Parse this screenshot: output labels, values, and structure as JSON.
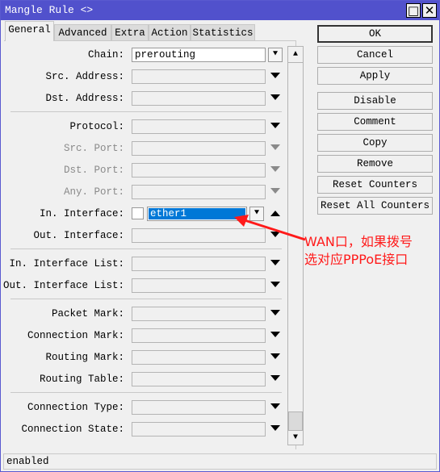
{
  "window": {
    "title": "Mangle Rule <>",
    "maximize_icon": "maximize-icon",
    "close_icon": "close-icon"
  },
  "tabs": [
    {
      "label": "General",
      "active": true
    },
    {
      "label": "Advanced"
    },
    {
      "label": "Extra"
    },
    {
      "label": "Action"
    },
    {
      "label": "Statistics"
    }
  ],
  "fields": {
    "chain": {
      "label": "Chain:",
      "value": "prerouting"
    },
    "src_address": {
      "label": "Src. Address:"
    },
    "dst_address": {
      "label": "Dst. Address:"
    },
    "protocol": {
      "label": "Protocol:"
    },
    "src_port": {
      "label": "Src. Port:",
      "disabled": true
    },
    "dst_port": {
      "label": "Dst. Port:",
      "disabled": true
    },
    "any_port": {
      "label": "Any. Port:",
      "disabled": true
    },
    "in_interface": {
      "label": "In. Interface:",
      "value": "ether1",
      "negate": false
    },
    "out_interface": {
      "label": "Out. Interface:"
    },
    "in_interface_list": {
      "label": "In. Interface List:"
    },
    "out_interface_list": {
      "label": "Out. Interface List:"
    },
    "packet_mark": {
      "label": "Packet Mark:"
    },
    "connection_mark": {
      "label": "Connection Mark:"
    },
    "routing_mark": {
      "label": "Routing Mark:"
    },
    "routing_table": {
      "label": "Routing Table:"
    },
    "connection_type": {
      "label": "Connection Type:"
    },
    "connection_state": {
      "label": "Connection State:"
    }
  },
  "buttons": [
    "OK",
    "Cancel",
    "Apply",
    "Disable",
    "Comment",
    "Copy",
    "Remove",
    "Reset Counters",
    "Reset All Counters"
  ],
  "annotation": {
    "line1": "WAN口，如果拨号",
    "line2": "选对应PPPoE接口",
    "color": "#ff1a1a"
  },
  "status": "enabled",
  "colors": {
    "titlebar": "#5151cc",
    "selection": "#0078d7"
  }
}
